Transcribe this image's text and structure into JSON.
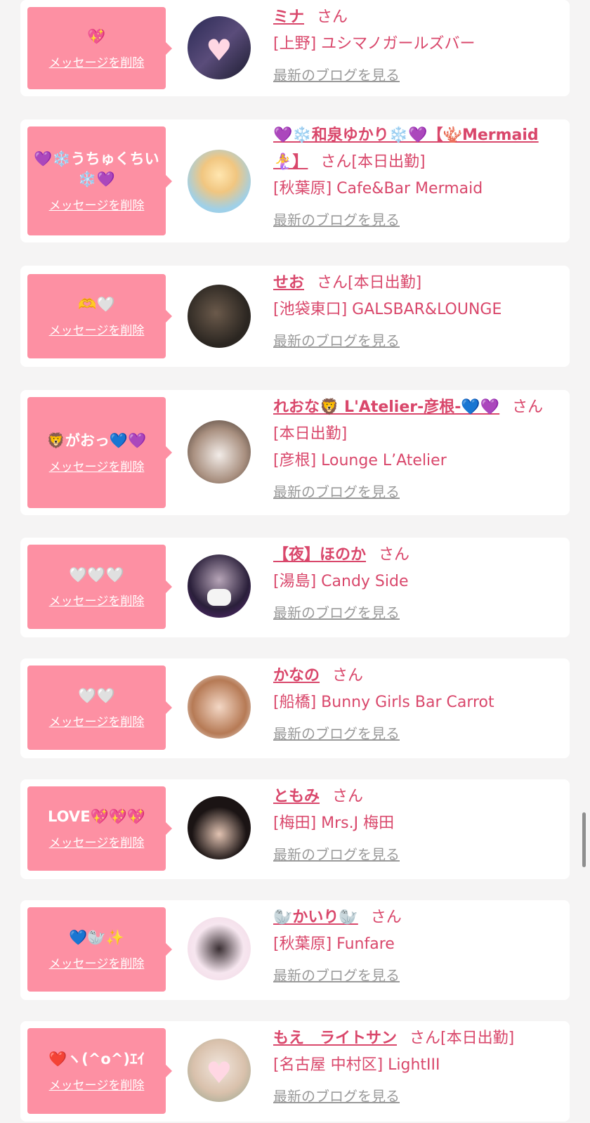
{
  "delete_label": "メッセージを削除",
  "blog_label": "最新のブログを見る",
  "san": "さん",
  "colors": {
    "bubble": "#fd90a3",
    "accent": "#d9476b",
    "link_gray": "#9a9a9a",
    "page_bg": "#f5f4f4"
  },
  "entries": [
    {
      "message": "💖",
      "name": "ミナ",
      "today": "",
      "shop": "[上野] ユシマノガールズバー",
      "avatar": "heart-mask-photo",
      "avatar_bg": "linear-gradient(135deg,#2a2a55,#5a4c7a,#1c1c30)"
    },
    {
      "message": "💜❄️うちゅくちい❄️💜",
      "name": "💜❄️和泉ゆかり❄️💜【🪸Mermaid🧜‍♀️】",
      "today": "[本日出勤]",
      "shop": "[秋葉原] Cafe&Bar Mermaid",
      "avatar": "photo",
      "avatar_bg": "radial-gradient(circle at 50% 40%,#ffe6b0,#f1c680 35%,#9fd0e8 70%)"
    },
    {
      "message": "🫶🤍",
      "name": "せお",
      "today": "[本日出勤]",
      "shop": "[池袋東口] GALSBAR&LOUNGE",
      "avatar": "photo",
      "avatar_bg": "radial-gradient(circle at 45% 45%,#6b5a4b,#2b2621 65%)"
    },
    {
      "message": "🦁がおっ💙💜",
      "name": "れおな🦁 L'Atelier-彦根-💙💜",
      "today": "[本日出勤]",
      "shop": "[彦根] Lounge L’Atelier",
      "avatar": "photo",
      "avatar_bg": "radial-gradient(circle at 50% 55%,#f2ece8,#a99080 55%,#3b302a)"
    },
    {
      "message": "🤍🤍🤍",
      "name": "【夜】ほのか",
      "today": "",
      "shop": "[湯島] Candy Side",
      "avatar": "mask-photo",
      "avatar_bg": "radial-gradient(circle at 50% 40%,#b7a5b8,#2a1f3a 60%,#5c2a7a)"
    },
    {
      "message": "🤍🤍",
      "name": "かなの",
      "today": "",
      "shop": "[船橋] Bunny Girls Bar Carrot",
      "avatar": "photo",
      "avatar_bg": "radial-gradient(circle at 50% 50%,#f3d7c5,#b67a55 60%,#f0efef)"
    },
    {
      "message": "LOVE💖💖💖",
      "name": "ともみ",
      "today": "",
      "shop": "[梅田] Mrs.J 梅田",
      "avatar": "photo",
      "avatar_bg": "radial-gradient(circle at 50% 60%,#e2c3b2,#1b1414 55%)"
    },
    {
      "message": "💙🦭✨",
      "name": "🦭かいり🦭",
      "today": "",
      "shop": "[秋葉原] Funfare",
      "avatar": "photo",
      "avatar_bg": "radial-gradient(circle at 50% 50%,#3a2f33,#f6e6ef 55%,#f3d8e6)"
    },
    {
      "message": "❤️ヽ(^o^)ｴｲ",
      "name": "もえ　ライトサン",
      "today": "[本日出勤]",
      "shop": "[名古屋 中村区] LightIII",
      "avatar": "heart-mask-photo",
      "avatar_bg": "radial-gradient(circle at 50% 45%,#f1e6dd,#d9c1ac 55%,#8fa38c)"
    }
  ]
}
